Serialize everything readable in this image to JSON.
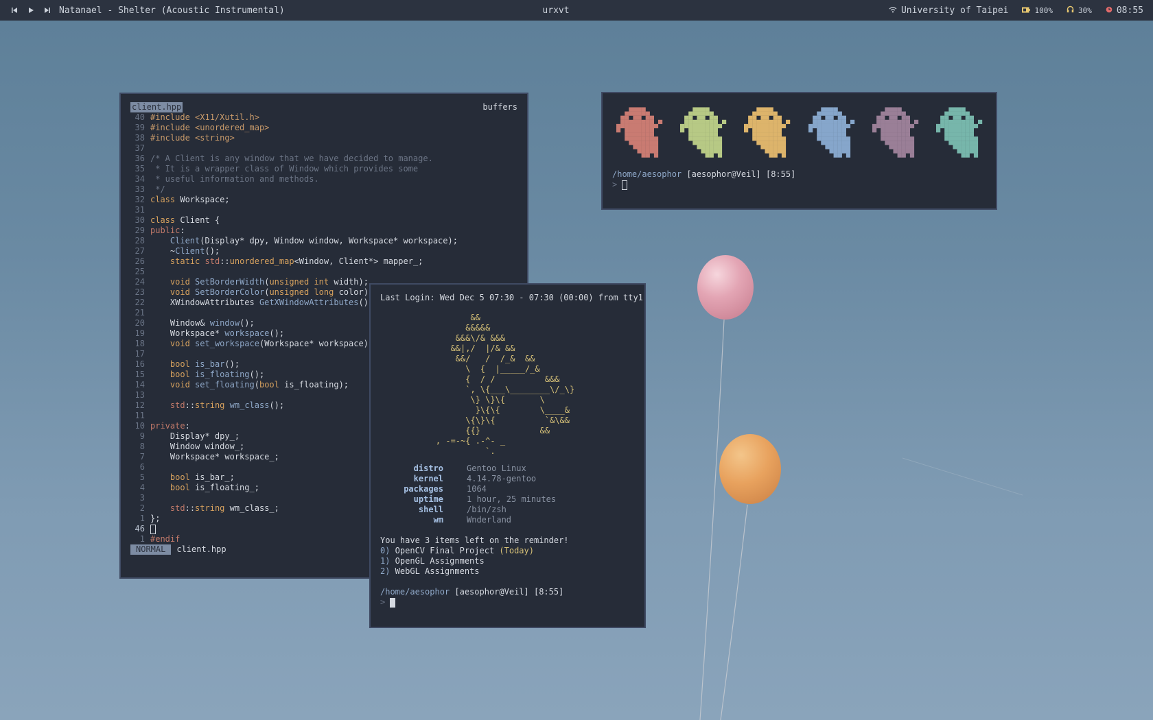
{
  "topbar": {
    "now_playing": "Natanael - Shelter (Acoustic Instrumental)",
    "window_title": "urxvt",
    "network": "University of Taipei",
    "battery": "100%",
    "volume": "30%",
    "clock": "08:55",
    "icons": [
      "prev-track-icon",
      "play-icon",
      "next-track-icon",
      "wifi-icon",
      "battery-icon",
      "headphones-icon",
      "clock-icon"
    ]
  },
  "vim": {
    "tab": "client.hpp",
    "buffers_label": "buffers",
    "mode": "NORMAL",
    "status_file": "client.hpp",
    "lines": [
      {
        "n": "40",
        "segs": [
          [
            "inc",
            "#include "
          ],
          [
            "str",
            "<X11/Xutil.h>"
          ]
        ]
      },
      {
        "n": "39",
        "segs": [
          [
            "inc",
            "#include "
          ],
          [
            "str",
            "<unordered_map>"
          ]
        ]
      },
      {
        "n": "38",
        "segs": [
          [
            "inc",
            "#include "
          ],
          [
            "str",
            "<string>"
          ]
        ]
      },
      {
        "n": "37",
        "segs": []
      },
      {
        "n": "36",
        "segs": [
          [
            "cm",
            "/* A Client is any window that we have decided to manage."
          ]
        ]
      },
      {
        "n": "35",
        "segs": [
          [
            "cm",
            " * It is a wrapper class of Window which provides some"
          ]
        ]
      },
      {
        "n": "34",
        "segs": [
          [
            "cm",
            " * useful information and methods."
          ]
        ]
      },
      {
        "n": "33",
        "segs": [
          [
            "cm",
            " */"
          ]
        ]
      },
      {
        "n": "32",
        "segs": [
          [
            "kw",
            "class"
          ],
          [
            "",
            " Workspace;"
          ]
        ]
      },
      {
        "n": "31",
        "segs": []
      },
      {
        "n": "30",
        "segs": [
          [
            "kw",
            "class"
          ],
          [
            "",
            " Client {"
          ]
        ]
      },
      {
        "n": "29",
        "segs": [
          [
            "acc",
            "public"
          ],
          [
            "",
            ":"
          ]
        ]
      },
      {
        "n": "28",
        "segs": [
          [
            "",
            "    "
          ],
          [
            "fn",
            "Client"
          ],
          [
            "",
            "(Display* dpy, Window window, Workspace* workspace);"
          ]
        ]
      },
      {
        "n": "27",
        "segs": [
          [
            "",
            "    ~"
          ],
          [
            "fn",
            "Client"
          ],
          [
            "",
            "();"
          ]
        ]
      },
      {
        "n": "26",
        "segs": [
          [
            "",
            "    "
          ],
          [
            "kw",
            "static"
          ],
          [
            "",
            " "
          ],
          [
            "acc",
            "std"
          ],
          [
            "",
            "::"
          ],
          [
            "ty",
            "unordered_map"
          ],
          [
            "",
            "<Window, Client*> mapper_;"
          ]
        ]
      },
      {
        "n": "25",
        "segs": []
      },
      {
        "n": "24",
        "segs": [
          [
            "",
            "    "
          ],
          [
            "kw",
            "void"
          ],
          [
            "",
            " "
          ],
          [
            "fn",
            "SetBorderWidth"
          ],
          [
            "",
            "("
          ],
          [
            "kw",
            "unsigned int"
          ],
          [
            "",
            " width);"
          ]
        ]
      },
      {
        "n": "23",
        "segs": [
          [
            "",
            "    "
          ],
          [
            "kw",
            "void"
          ],
          [
            "",
            " "
          ],
          [
            "fn",
            "SetBorderColor"
          ],
          [
            "",
            "("
          ],
          [
            "kw",
            "unsigned long"
          ],
          [
            "",
            " color);"
          ]
        ]
      },
      {
        "n": "22",
        "segs": [
          [
            "",
            "    XWindowAttributes "
          ],
          [
            "fn",
            "GetXWindowAttributes"
          ],
          [
            "",
            "();"
          ]
        ]
      },
      {
        "n": "21",
        "segs": []
      },
      {
        "n": "20",
        "segs": [
          [
            "",
            "    Window& "
          ],
          [
            "fn",
            "window"
          ],
          [
            "",
            "();"
          ]
        ]
      },
      {
        "n": "19",
        "segs": [
          [
            "",
            "    Workspace* "
          ],
          [
            "fn",
            "workspace"
          ],
          [
            "",
            "();"
          ]
        ]
      },
      {
        "n": "18",
        "segs": [
          [
            "",
            "    "
          ],
          [
            "kw",
            "void"
          ],
          [
            "",
            " "
          ],
          [
            "fn",
            "set_workspace"
          ],
          [
            "",
            "(Workspace* workspace);"
          ]
        ]
      },
      {
        "n": "17",
        "segs": []
      },
      {
        "n": "16",
        "segs": [
          [
            "",
            "    "
          ],
          [
            "kw",
            "bool"
          ],
          [
            "",
            " "
          ],
          [
            "fn",
            "is_bar"
          ],
          [
            "",
            "();"
          ]
        ]
      },
      {
        "n": "15",
        "segs": [
          [
            "",
            "    "
          ],
          [
            "kw",
            "bool"
          ],
          [
            "",
            " "
          ],
          [
            "fn",
            "is_floating"
          ],
          [
            "",
            "();"
          ]
        ]
      },
      {
        "n": "14",
        "segs": [
          [
            "",
            "    "
          ],
          [
            "kw",
            "void"
          ],
          [
            "",
            " "
          ],
          [
            "fn",
            "set_floating"
          ],
          [
            "",
            "("
          ],
          [
            "kw",
            "bool"
          ],
          [
            "",
            " is_floating);"
          ]
        ]
      },
      {
        "n": "13",
        "segs": []
      },
      {
        "n": "12",
        "segs": [
          [
            "",
            "    "
          ],
          [
            "acc",
            "std"
          ],
          [
            "",
            "::"
          ],
          [
            "kw",
            "string"
          ],
          [
            "",
            " "
          ],
          [
            "fn",
            "wm_class"
          ],
          [
            "",
            "();"
          ]
        ]
      },
      {
        "n": "11",
        "segs": []
      },
      {
        "n": "10",
        "segs": [
          [
            "acc",
            "private"
          ],
          [
            "",
            ":"
          ]
        ]
      },
      {
        "n": "9",
        "segs": [
          [
            "",
            "    Display* dpy_;"
          ]
        ]
      },
      {
        "n": "8",
        "segs": [
          [
            "",
            "    Window window_;"
          ]
        ]
      },
      {
        "n": "7",
        "segs": [
          [
            "",
            "    Workspace* workspace_;"
          ]
        ]
      },
      {
        "n": "6",
        "segs": []
      },
      {
        "n": "5",
        "segs": [
          [
            "",
            "    "
          ],
          [
            "kw",
            "bool"
          ],
          [
            "",
            " is_bar_;"
          ]
        ]
      },
      {
        "n": "4",
        "segs": [
          [
            "",
            "    "
          ],
          [
            "kw",
            "bool"
          ],
          [
            "",
            " is_floating_;"
          ]
        ]
      },
      {
        "n": "3",
        "segs": []
      },
      {
        "n": "2",
        "segs": [
          [
            "",
            "    "
          ],
          [
            "acc",
            "std"
          ],
          [
            "",
            "::"
          ],
          [
            "kw",
            "string"
          ],
          [
            "",
            " wm_class_;"
          ]
        ]
      },
      {
        "n": "1",
        "segs": [
          [
            "",
            "};"
          ]
        ]
      },
      {
        "n": "46",
        "cur": true,
        "cursor": true,
        "segs": []
      },
      {
        "n": "1",
        "segs": [
          [
            "acc",
            "#endif"
          ]
        ]
      }
    ]
  },
  "fetch": {
    "last_login": "Last Login: Wed Dec 5 07:30 - 07:30 (00:00) from tty1",
    "ascii_art": "           &&\n          &&&&&\n        &&&\\/& &&&\n       &&|,/  |/& &&\n        &&/   /  /_&  &&\n          \\  {  |_____/_&\n          {  / /          &&&\n          `, \\{___\\________\\/_\\}\n           \\} \\}\\{       \\\n            }\\{\\{        \\____&\n          \\{\\}\\{          `&\\&&\n          {{}            &&\n    , -=-~{ .-^- _\n              `.",
    "info": [
      {
        "key": "distro",
        "val": "Gentoo Linux"
      },
      {
        "key": "kernel",
        "val": "4.14.78-gentoo"
      },
      {
        "key": "packages",
        "val": "1064"
      },
      {
        "key": "uptime",
        "val": "1 hour, 25 minutes"
      },
      {
        "key": "shell",
        "val": "/bin/zsh"
      },
      {
        "key": "wm",
        "val": "Wnderland"
      }
    ],
    "reminder_header": "You have 3 items left on the reminder!",
    "reminders": [
      {
        "num": "0)",
        "text": " OpenCV Final Project ",
        "tag": "(Today)"
      },
      {
        "num": "1)",
        "text": " OpenGL Assignments",
        "tag": ""
      },
      {
        "num": "2)",
        "text": " WebGL Assignments",
        "tag": ""
      }
    ],
    "prompt_path": "/home/aesophor",
    "prompt_host": " [aesophor@Veil] [8:55]",
    "prompt_char": ">"
  },
  "ghost_term": {
    "ghost_colors": [
      "#c97b72",
      "#b7c985",
      "#ddb46b",
      "#86a6cb",
      "#9a7f97",
      "#77b6ab"
    ],
    "prompt_path": "/home/aesophor",
    "prompt_host": " [aesophor@Veil] [8:55]",
    "prompt_char": ">"
  },
  "colors": {
    "term_bg": "#262c38",
    "bar_bg": "#2c3340",
    "border": "#3f4a63"
  }
}
